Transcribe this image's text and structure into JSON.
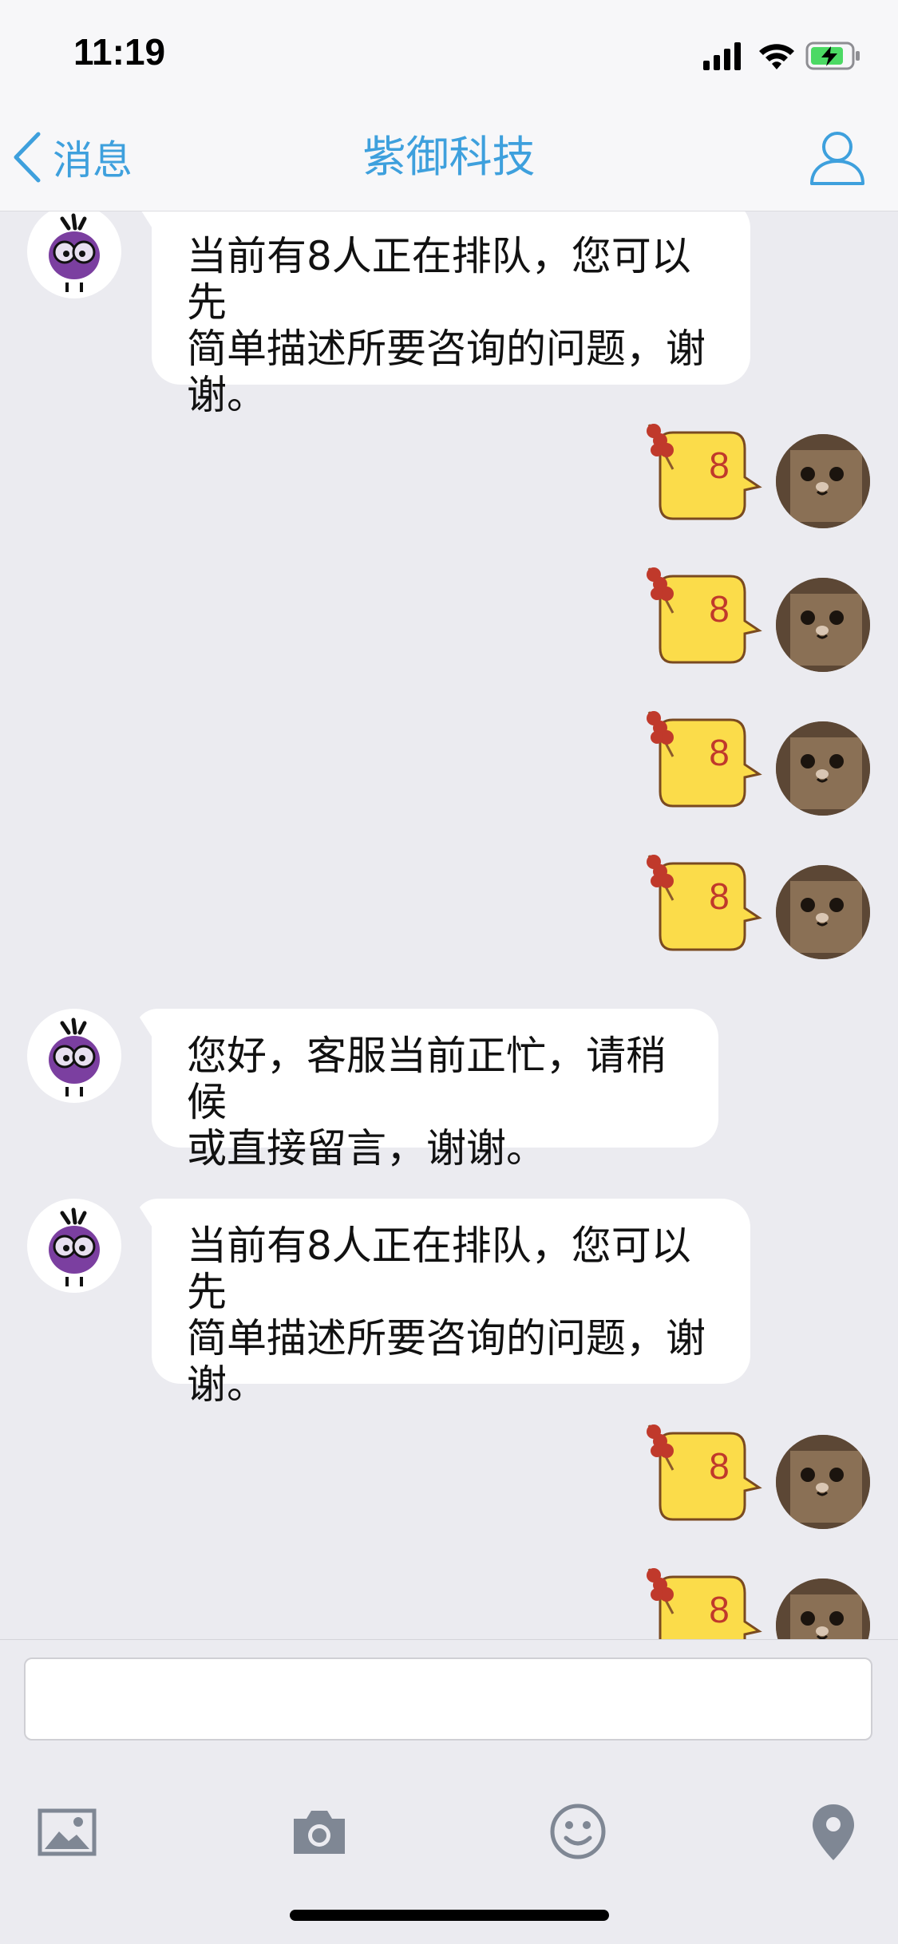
{
  "status_bar": {
    "time": "11:19",
    "icons": [
      "signal-icon",
      "wifi-icon",
      "battery-charging-icon"
    ]
  },
  "nav": {
    "back_label": "消息",
    "title": "紫御科技",
    "accent_color": "#3ea0dd",
    "profile_icon": "person-icon"
  },
  "messages": [
    {
      "from": "bot",
      "text": "当前有8人正在排队，您可以先\n简单描述所要咨询的问题，谢\n谢。"
    },
    {
      "from": "user",
      "sticker": "8"
    },
    {
      "from": "user",
      "sticker": "8"
    },
    {
      "from": "user",
      "sticker": "8"
    },
    {
      "from": "user",
      "sticker": "8"
    },
    {
      "from": "bot",
      "text": "您好，客服当前正忙，请稍候\n或直接留言，谢谢。"
    },
    {
      "from": "bot",
      "text": "当前有8人正在排队，您可以先\n简单描述所要咨询的问题，谢\n谢。"
    },
    {
      "from": "user",
      "sticker": "8"
    },
    {
      "from": "user",
      "sticker": "8"
    }
  ],
  "composer": {
    "input_value": "",
    "tools": [
      "image-icon",
      "camera-icon",
      "emoji-icon",
      "location-pin-icon"
    ]
  }
}
